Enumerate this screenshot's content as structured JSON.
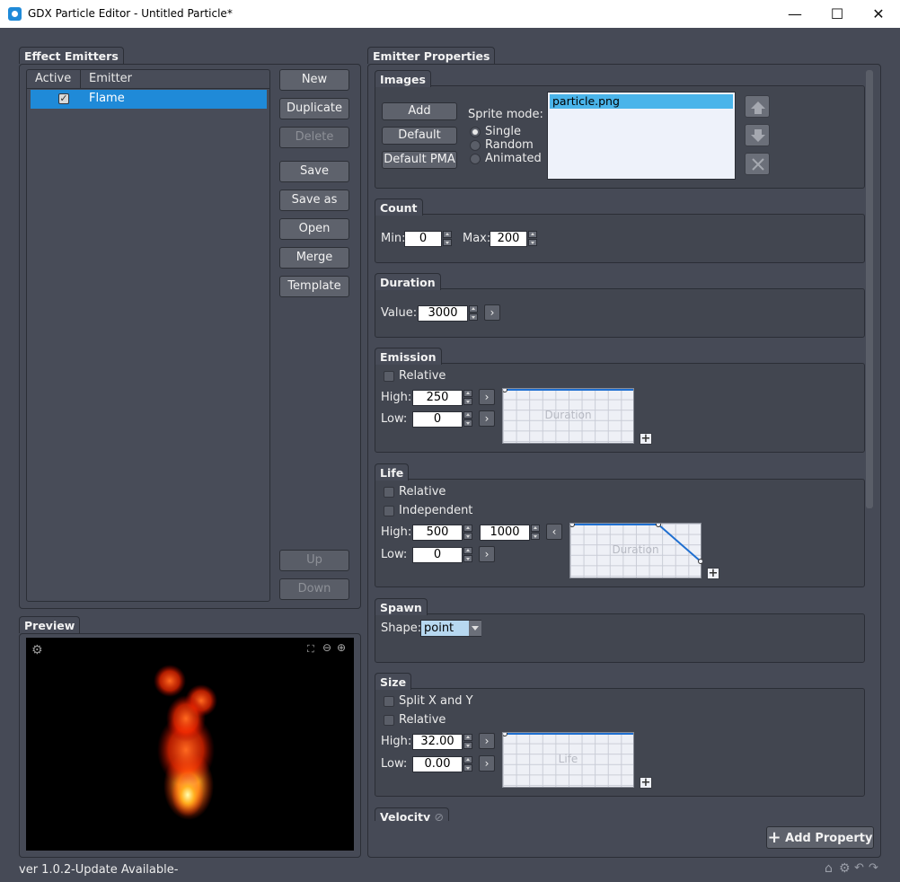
{
  "window": {
    "title": "GDX Particle Editor - Untitled Particle*",
    "minimize": "—",
    "maximize": "☐",
    "close": "✕"
  },
  "effect_emitters": {
    "title": "Effect Emitters",
    "columns": [
      "Active",
      "Emitter"
    ],
    "rows": [
      {
        "active": true,
        "name": "Flame",
        "selected": true
      }
    ],
    "buttons": {
      "new": "New",
      "duplicate": "Duplicate",
      "delete": "Delete",
      "save": "Save",
      "save_as": "Save as",
      "open": "Open",
      "merge": "Merge",
      "template": "Template",
      "up": "Up",
      "down": "Down"
    }
  },
  "preview": {
    "title": "Preview"
  },
  "emitter_properties": {
    "title": "Emitter Properties",
    "images": {
      "title": "Images",
      "add": "Add",
      "default": "Default",
      "default_pma": "Default PMA",
      "sprite_mode_label": "Sprite mode:",
      "modes": [
        "Single",
        "Random",
        "Animated"
      ],
      "selected_mode": "Single",
      "files": [
        "particle.png"
      ]
    },
    "count": {
      "title": "Count",
      "min_label": "Min:",
      "min": "0",
      "max_label": "Max:",
      "max": "200"
    },
    "duration": {
      "title": "Duration",
      "value_label": "Value:",
      "value": "3000"
    },
    "emission": {
      "title": "Emission",
      "relative": "Relative",
      "high_label": "High:",
      "high": "250",
      "low_label": "Low:",
      "low": "0",
      "graph_label": "Duration"
    },
    "life": {
      "title": "Life",
      "relative": "Relative",
      "independent": "Independent",
      "high_label": "High:",
      "high": "500",
      "high2": "1000",
      "low_label": "Low:",
      "low": "0",
      "graph_label": "Duration"
    },
    "spawn": {
      "title": "Spawn",
      "shape_label": "Shape:",
      "shape": "point"
    },
    "size": {
      "title": "Size",
      "split": "Split X and Y",
      "relative": "Relative",
      "high_label": "High:",
      "high": "32.00",
      "low_label": "Low:",
      "low": "0.00",
      "graph_label": "Life"
    },
    "velocity": {
      "title": "Velocity"
    },
    "add_property": "Add Property"
  },
  "status": {
    "version": "ver 1.0.2",
    "update": "-Update Available-"
  }
}
